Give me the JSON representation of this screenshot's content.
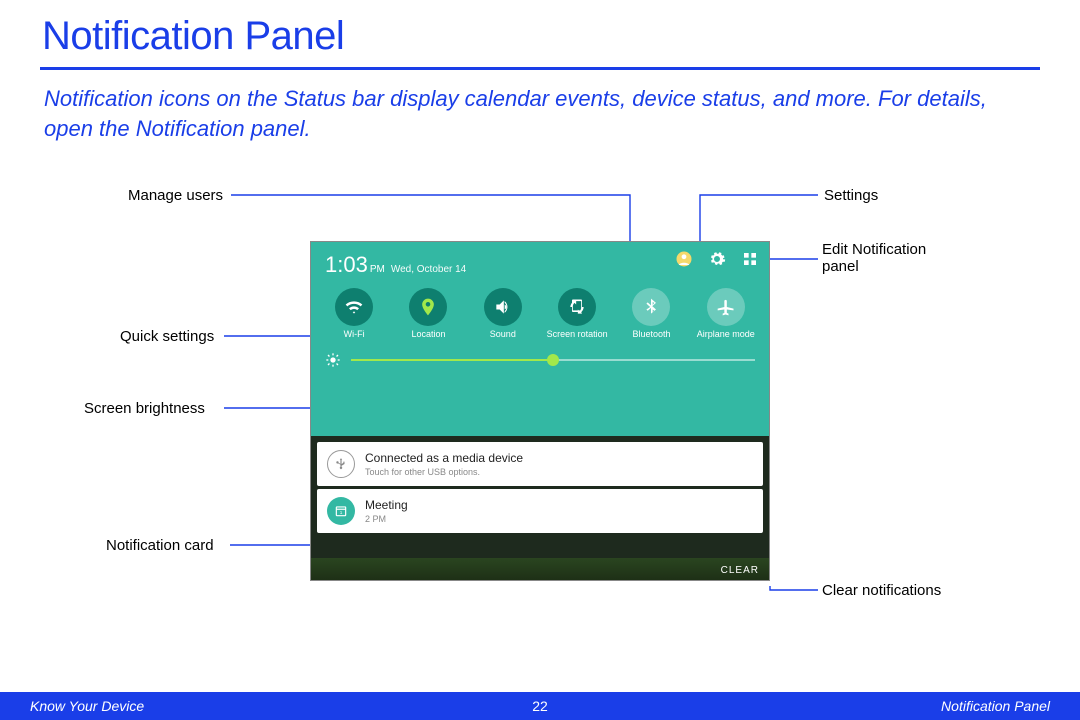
{
  "page": {
    "title": "Notification Panel",
    "intro": "Notification icons on the Status bar display calendar events, device status, and more. For details, open the Notification panel."
  },
  "device": {
    "time": "1:03",
    "ampm": "PM",
    "date": "Wed, October 14",
    "qs": [
      {
        "label": "Wi-Fi"
      },
      {
        "label": "Location"
      },
      {
        "label": "Sound"
      },
      {
        "label": "Screen rotation"
      },
      {
        "label": "Bluetooth"
      },
      {
        "label": "Airplane mode"
      }
    ],
    "cards": [
      {
        "title": "Connected as a media device",
        "sub": "Touch for other USB options."
      },
      {
        "title": "Meeting",
        "sub": "2 PM"
      }
    ],
    "clear": "CLEAR"
  },
  "callouts": {
    "manage_users": "Manage users",
    "quick_settings": "Quick settings",
    "screen_brightness": "Screen brightness",
    "notification_card": "Notification card",
    "settings": "Settings",
    "edit_panel": "Edit Notification panel",
    "clear_notifications": "Clear notifications"
  },
  "footer": {
    "left": "Know Your Device",
    "center": "22",
    "right": "Notification Panel"
  }
}
